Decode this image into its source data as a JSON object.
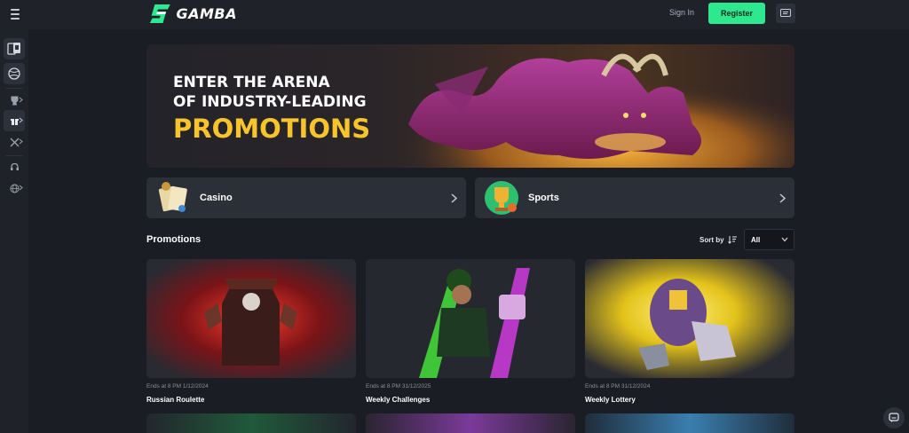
{
  "header": {
    "logo_text": "GAMBA",
    "signin_label": "Sign In",
    "register_label": "Register"
  },
  "sidebar": {
    "items": [
      {
        "icon": "casino-cards-icon"
      },
      {
        "icon": "sports-ball-icon"
      },
      {
        "icon": "trophy-icon"
      },
      {
        "icon": "gift-icon"
      },
      {
        "icon": "swords-icon"
      },
      {
        "icon": "headset-icon"
      },
      {
        "icon": "globe-icon"
      }
    ]
  },
  "hero": {
    "line1": "ENTER THE ARENA",
    "line2": "OF INDUSTRY-LEADING",
    "line3": "PROMOTIONS"
  },
  "categories": [
    {
      "label": "Casino",
      "icon": "casino-cards-icon"
    },
    {
      "label": "Sports",
      "icon": "sports-trophy-icon"
    }
  ],
  "promotions": {
    "title": "Promotions",
    "sort_label": "Sort by",
    "filter_value": "All",
    "cards": [
      {
        "date": "Ends at 8 PM 1/12/2024",
        "name": "Russian Roulette",
        "accent": "#e0282a"
      },
      {
        "date": "Ends at 8 PM 31/12/2025",
        "name": "Weekly Challenges",
        "accent": "#46e03a"
      },
      {
        "date": "Ends at 8 PM 31/12/2024",
        "name": "Weekly Lottery",
        "accent": "#f2d21b"
      }
    ]
  },
  "colors": {
    "brand_green": "#2ee88f",
    "promo_yellow": "#f7c52b",
    "background": "#1a1d24",
    "panel": "#2b2f38"
  }
}
